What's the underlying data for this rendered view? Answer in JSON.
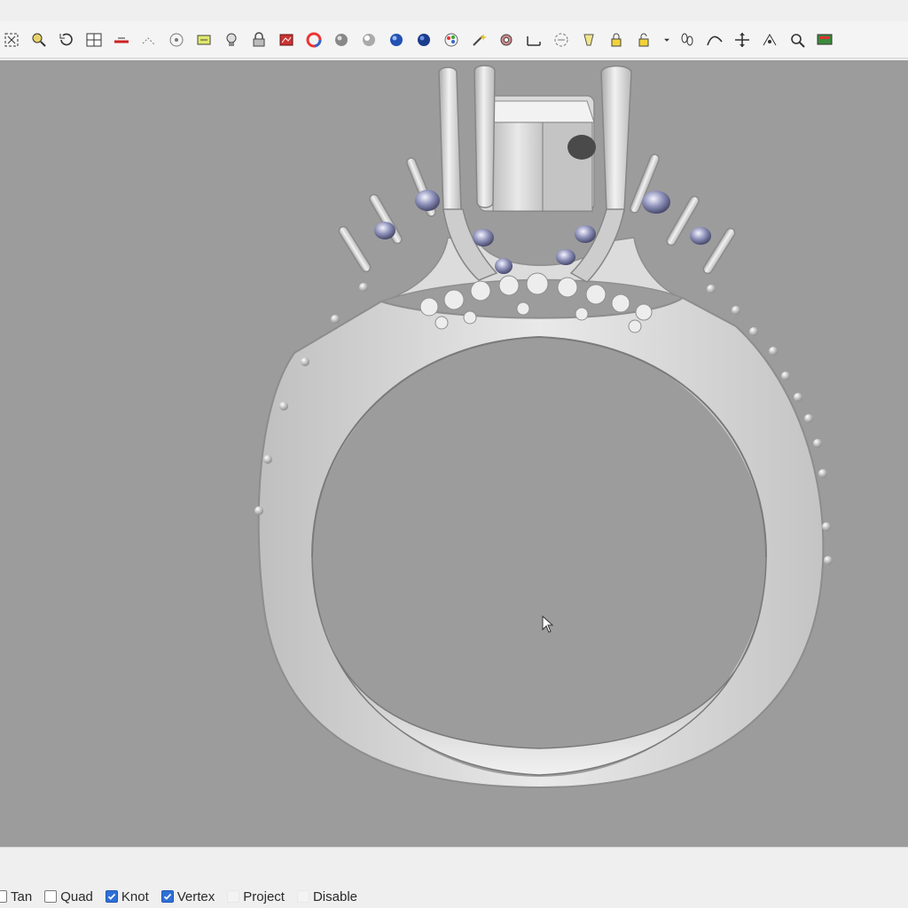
{
  "toolbar": {
    "tools": [
      "zoom-extents-icon",
      "zoom-window-icon",
      "undo-view-icon",
      "four-viewports-icon",
      "set-cplane-icon",
      "cplane-elevation-icon",
      "target-icon",
      "named-view-icon",
      "bulb-icon",
      "lock-icon",
      "render-icon",
      "color-wheel-icon",
      "sphere-gray-icon",
      "sphere-silver-icon",
      "sphere-blue-icon",
      "sphere-blue-dark-icon",
      "color-palette-icon",
      "magic-wand-icon",
      "gear-icon",
      "dimension-icon",
      "snap-settings-icon",
      "light-icon",
      "padlock-icon",
      "padlock-open-icon",
      "dropdown-arrow-icon",
      "footprints-icon",
      "curve-tool-icon",
      "move-icon",
      "transform-icon",
      "analyze-icon",
      "monitor-icon"
    ]
  },
  "viewport": {
    "background": "#9c9c9c",
    "model": "ring-3d-model",
    "cursor": "mouse-pointer-icon"
  },
  "osnap": [
    {
      "label": "Tan",
      "checked": false
    },
    {
      "label": "Quad",
      "checked": false
    },
    {
      "label": "Knot",
      "checked": true
    },
    {
      "label": "Vertex",
      "checked": true
    },
    {
      "label": "Project",
      "checked": false
    },
    {
      "label": "Disable",
      "checked": false
    }
  ],
  "colors": {
    "accent": "#2f6fd6",
    "metal": "#d8d8d8",
    "gem": "#5a5e88"
  }
}
